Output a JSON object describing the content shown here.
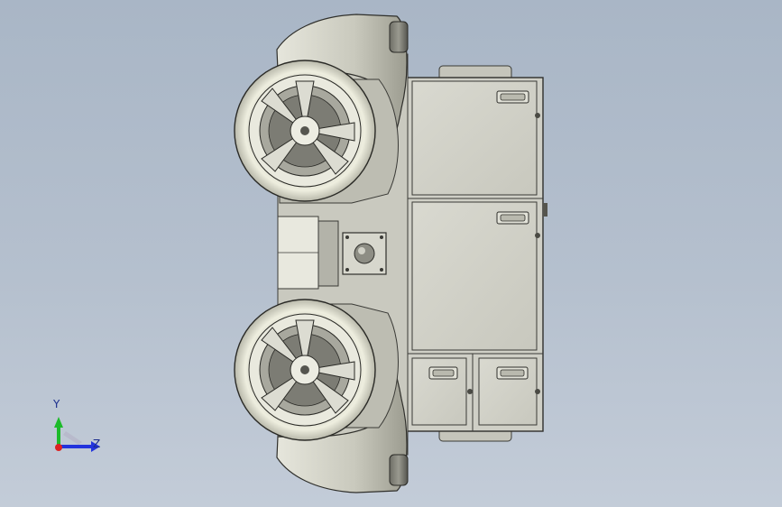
{
  "viewport": {
    "background_top": "#a9b6c6",
    "background_bottom": "#c3ccd8",
    "model": "vehicle-top-view"
  },
  "triad": {
    "y_label": "Y",
    "z_label": "Z",
    "y_color": "#1dbb2a",
    "z_color": "#2233dd",
    "x_color": "#dd2222"
  }
}
